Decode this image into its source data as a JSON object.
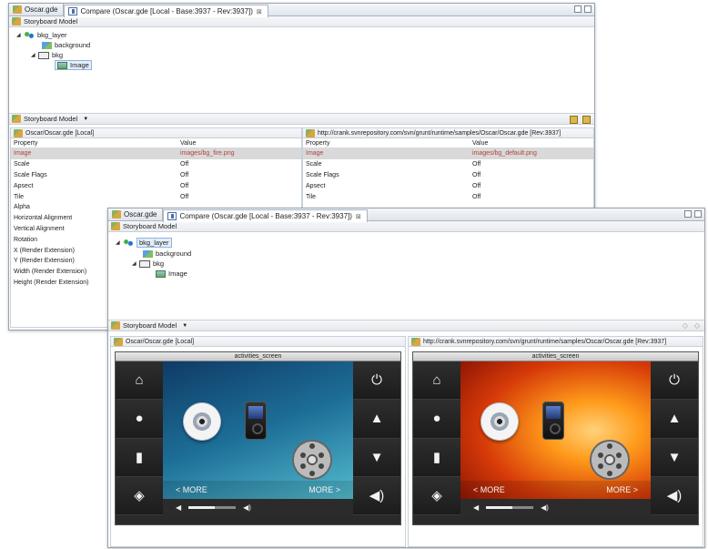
{
  "back_window": {
    "tabs": [
      {
        "label": "Oscar.gde",
        "active": false
      },
      {
        "label": "Compare (Oscar.gde [Local - Base:3937 - Rev:3937])",
        "active": true,
        "close": "⊠"
      }
    ],
    "storyboard_model_title": "Storyboard Model",
    "tree": [
      {
        "label": "bkg_layer",
        "icon": "layer-icon",
        "expanded": true,
        "level": 0
      },
      {
        "label": "background",
        "icon": "image-icon",
        "level": 1
      },
      {
        "label": "bkg",
        "icon": "group-icon",
        "expanded": true,
        "level": 1
      },
      {
        "label": "Image",
        "icon": "image-icon",
        "level": 2,
        "selected": true
      }
    ],
    "toolbar_title": "Storyboard Model",
    "left_panel": {
      "path": "Oscar/Oscar.gde [Local]",
      "headers": [
        "Property",
        "Value"
      ],
      "rows": [
        {
          "p": "Image",
          "v": "images/bg_fire.png",
          "hl": true
        },
        {
          "p": "Scale",
          "v": "Off"
        },
        {
          "p": "Scale Flags",
          "v": "Off"
        },
        {
          "p": "Apsect",
          "v": "Off"
        },
        {
          "p": "Tile",
          "v": "Off"
        },
        {
          "p": "Alpha",
          "v": ""
        },
        {
          "p": "Horizontal Alignment",
          "v": ""
        },
        {
          "p": "Vertical Alignment",
          "v": ""
        },
        {
          "p": "Rotation",
          "v": ""
        },
        {
          "p": "X (Render Extension)",
          "v": ""
        },
        {
          "p": "Y (Render Extension)",
          "v": ""
        },
        {
          "p": "Width (Render Extension)",
          "v": ""
        },
        {
          "p": "Height (Render Extension)",
          "v": ""
        }
      ]
    },
    "right_panel": {
      "path": "http://crank.svnrepository.com/svn/grunt/runtime/samples/Oscar/Oscar.gde [Rev:3937]",
      "headers": [
        "Property",
        "Value"
      ],
      "rows": [
        {
          "p": "Image",
          "v": "images/bg_default.png",
          "hl": true
        },
        {
          "p": "Scale",
          "v": "Off"
        },
        {
          "p": "Scale Flags",
          "v": "Off"
        },
        {
          "p": "Apsect",
          "v": "Off"
        },
        {
          "p": "Tile",
          "v": "Off"
        }
      ]
    }
  },
  "front_window": {
    "tabs": [
      {
        "label": "Oscar.gde",
        "active": false
      },
      {
        "label": "Compare (Oscar.gde [Local - Base:3937 - Rev:3937])",
        "active": true,
        "close": "⊠"
      }
    ],
    "storyboard_model_title": "Storyboard Model",
    "tree": [
      {
        "label": "bkg_layer",
        "level": 0,
        "selected": true
      },
      {
        "label": "background",
        "level": 1
      },
      {
        "label": "bkg",
        "level": 1
      },
      {
        "label": "Image",
        "level": 2
      }
    ],
    "toolbar_title": "Storyboard Model",
    "left_path": "Oscar/Oscar.gde [Local]",
    "right_path": "http://crank.svnrepository.com/svn/grunt/runtime/samples/Oscar/Oscar.gde [Rev:3937]",
    "screen_title": "activities_screen",
    "more_left": "< MORE",
    "more_right": "MORE >",
    "left_buttons": [
      "home-icon",
      "bulb-icon",
      "thermometer-icon",
      "shield-icon"
    ],
    "right_buttons": [
      "power-icon",
      "up-arrow-icon",
      "down-arrow-icon",
      "speaker-icon"
    ],
    "volume_level": 0.55,
    "colors": {
      "local_bg_top": "#0f3b66",
      "local_bg_bottom": "#5cc7d6",
      "remote_bg_top": "#7a0c04",
      "remote_bg_bottom": "#ff9a1a"
    }
  }
}
